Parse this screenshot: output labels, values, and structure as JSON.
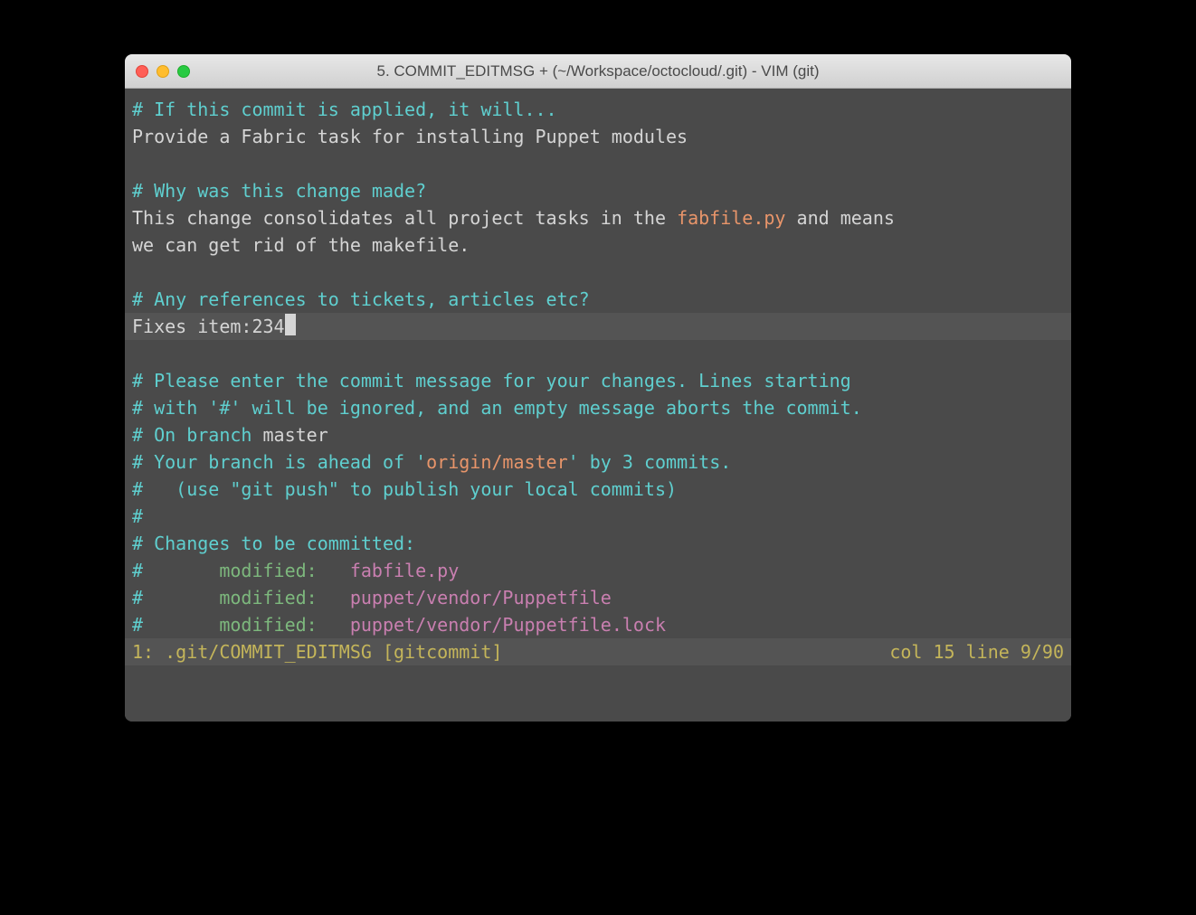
{
  "window": {
    "title": "5. COMMIT_EDITMSG + (~/Workspace/octocloud/.git) - VIM (git)"
  },
  "editor": {
    "lines": {
      "comment1": "# If this commit is applied, it will...",
      "text1": "Provide a Fabric task for installing Puppet modules",
      "comment2": "# Why was this change made?",
      "text2_part1": "This change consolidates all project tasks in the ",
      "text2_fabfile": "fabfile.py",
      "text2_part2": " and means",
      "text3": "we can get rid of the makefile.",
      "comment3": "# Any references to tickets, articles etc?",
      "text4": "Fixes item:234",
      "git1": "# Please enter the commit message for your changes. Lines starting",
      "git2": "# with '#' will be ignored, and an empty message aborts the commit.",
      "git3_prefix": "# On branch ",
      "git3_branch": "master",
      "git4_prefix": "# Your branch is ahead of '",
      "git4_remote": "origin/master",
      "git4_suffix": "' by 3 commits.",
      "git5": "#   (use \"git push\" to publish your local commits)",
      "git6": "#",
      "git7": "# Changes to be committed:",
      "hash": "#",
      "modified_label": "modified:",
      "file1": "fabfile.py",
      "file2": "puppet/vendor/Puppetfile",
      "file3": "puppet/vendor/Puppetfile.lock"
    }
  },
  "statusbar": {
    "left": "1: .git/COMMIT_EDITMSG [gitcommit]",
    "right": "col 15 line 9/90"
  }
}
